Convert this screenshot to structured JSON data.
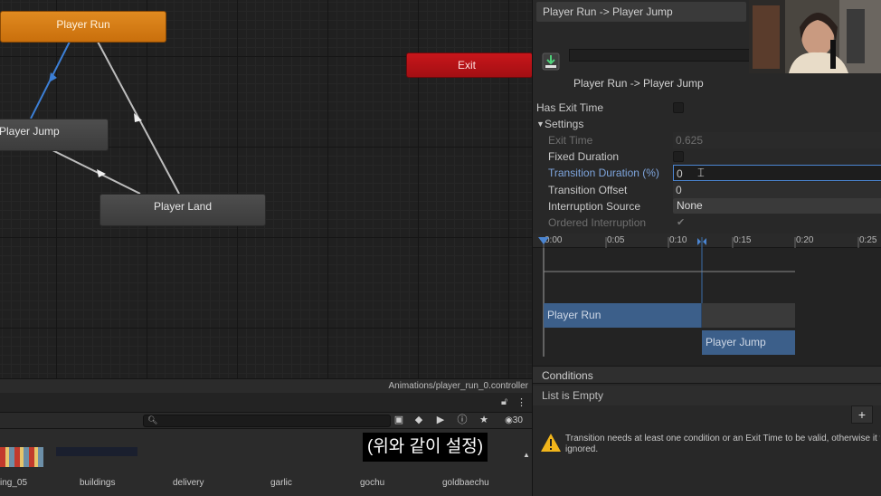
{
  "graph": {
    "states": {
      "player_run": "Player Run",
      "player_jump": "Player Jump",
      "player_land": "Player Land",
      "exit": "Exit"
    }
  },
  "status_bar": {
    "path": "Animations/player_run_0.controller"
  },
  "project": {
    "search_placeholder": "",
    "visible_count": "30",
    "assets": [
      "ing_05",
      "buildings",
      "delivery",
      "garlic",
      "gochu",
      "goldbaechu"
    ]
  },
  "subtitle": "(위와 같이 설정)",
  "inspector": {
    "title": "Player Run -> Player Jump",
    "transition_name": "Player Run -> Player Jump",
    "has_exit_time_label": "Has Exit Time",
    "settings_label": "Settings",
    "exit_time_label": "Exit Time",
    "exit_time_value": "0.625",
    "fixed_duration_label": "Fixed Duration",
    "transition_duration_label": "Transition Duration (%)",
    "transition_duration_value": "0",
    "transition_offset_label": "Transition Offset",
    "transition_offset_value": "0",
    "interruption_source_label": "Interruption Source",
    "interruption_source_value": "None",
    "ordered_interruption_label": "Ordered Interruption",
    "timeline": {
      "ticks": [
        "0:00",
        "0:05",
        "0:10",
        "0:15",
        "0:20",
        "0:25"
      ],
      "source_bar": "Player Run",
      "destination_bar": "Player Jump"
    },
    "conditions_label": "Conditions",
    "conditions_empty": "List is Empty",
    "add_label": "+",
    "warning": "Transition needs at least one condition or an Exit Time to be valid, otherwise it w",
    "warning_line2": "ignored."
  },
  "colors": {
    "state_default": "#e08a20",
    "state_exit": "#c8161b",
    "accent_blue": "#4b85d1",
    "timeline_bar": "#3c5f8a"
  }
}
